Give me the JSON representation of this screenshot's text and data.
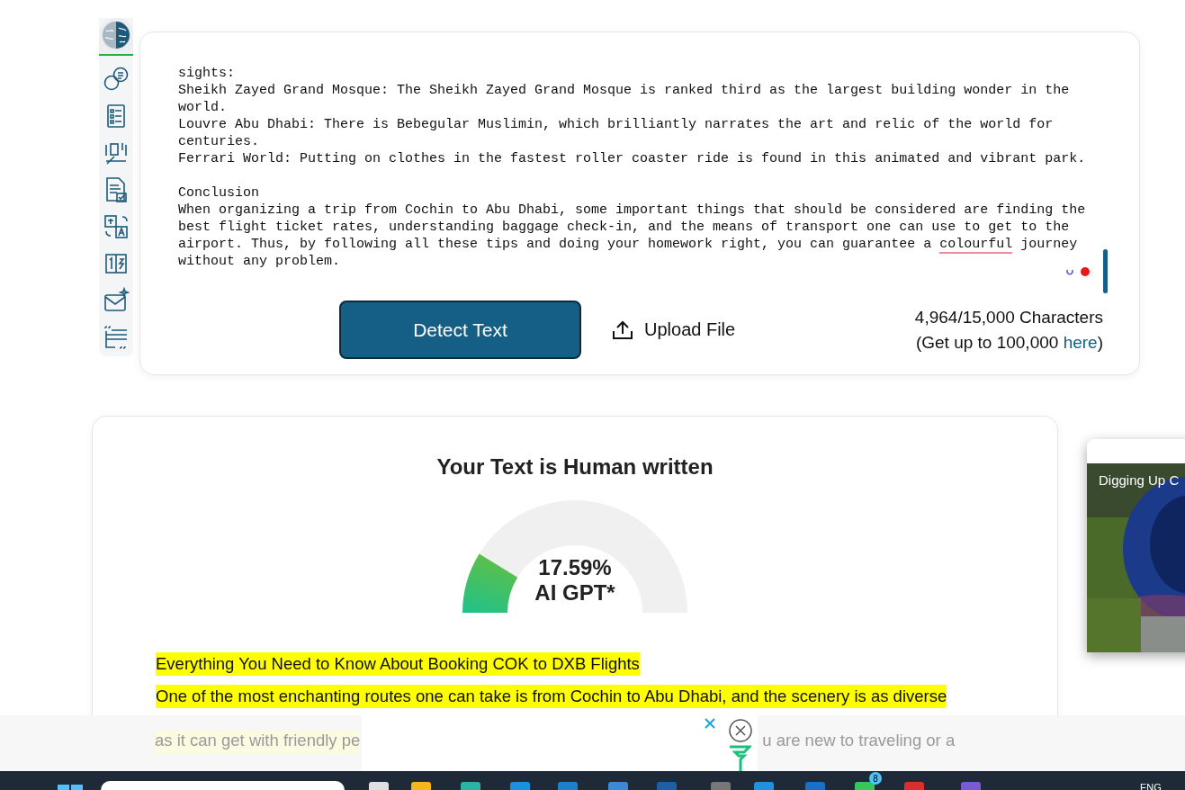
{
  "sidebar": {
    "items": [
      {
        "kind": "brain",
        "selected": true
      },
      {
        "kind": "chat",
        "selected": false
      },
      {
        "kind": "list",
        "selected": false
      },
      {
        "kind": "flow",
        "selected": false
      },
      {
        "kind": "doccheck",
        "selected": false
      },
      {
        "kind": "translate",
        "selected": false
      },
      {
        "kind": "numbers",
        "selected": false
      },
      {
        "kind": "mail",
        "selected": false
      },
      {
        "kind": "quote",
        "selected": false
      }
    ]
  },
  "editor": {
    "blocks": [
      {
        "paragraphs": [
          {
            "segments": [
              {
                "text": "sights:",
                "flagged": false
              }
            ]
          },
          {
            "segments": [
              {
                "text": "Sheikh Zayed Grand Mosque: The Sheikh Zayed Grand Mosque is ranked third as the largest building wonder in the world.",
                "flagged": false
              }
            ]
          },
          {
            "segments": [
              {
                "text": "Louvre Abu Dhabi: There is Bebegular Muslimin, which brilliantly narrates the art and relic of the world for centuries.",
                "flagged": false
              }
            ]
          },
          {
            "segments": [
              {
                "text": "Ferrari World: Putting on clothes in the fastest roller coaster ride is found in this animated and vibrant park.",
                "flagged": false
              }
            ]
          }
        ]
      },
      {
        "paragraphs": [
          {
            "segments": [
              {
                "text": "Conclusion",
                "flagged": false
              }
            ]
          },
          {
            "segments": [
              {
                "text": "When organizing a trip from Cochin to Abu Dhabi, some important things that should be considered are finding the best flight ticket rates, understanding baggage check-in, and the means of transport one can use to get to the airport. Thus, by following all these tips and doing your homework right, you can guarantee a ",
                "flagged": false
              },
              {
                "text": "colourful",
                "flagged": true
              },
              {
                "text": " journey without any problem.",
                "flagged": false
              }
            ]
          }
        ]
      }
    ],
    "detect_button": "Detect Text",
    "upload_button": "Upload File",
    "character_count": "4,964/15,000 Characters",
    "upgrade_note": {
      "before": "(Get up to 100,000 ",
      "link": "here",
      "after": ")"
    }
  },
  "result": {
    "title": "Your Text is Human written",
    "gauge": {
      "level": 0.1759,
      "value": "17.59%",
      "label": "AI GPT*"
    },
    "highlighted_lines": [
      "Everything You Need to Know About Booking COK to DXB Flights",
      "One of the most enchanting routes one can take is from Cochin to Abu Dhabi, and the scenery is as diverse"
    ]
  },
  "ad_overlay": {
    "text_left": "as it can get with friendly pe",
    "text_right": "u are new to traveling or a"
  },
  "video": {
    "title": "Digging Up C"
  },
  "taskbar": {
    "badge": "8",
    "language": "ENG"
  }
}
